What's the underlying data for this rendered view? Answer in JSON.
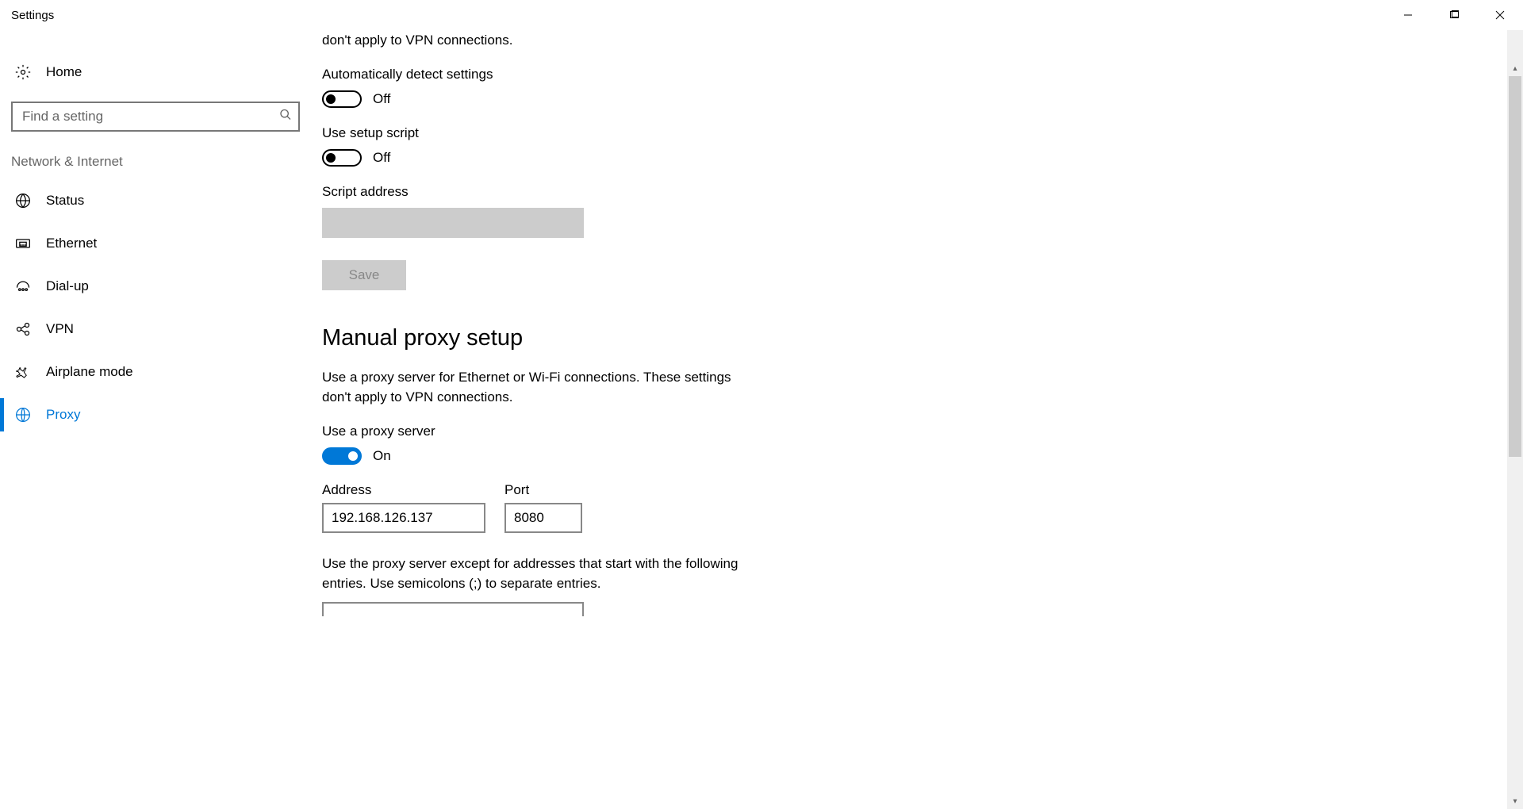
{
  "window": {
    "title": "Settings"
  },
  "sidebar": {
    "home": "Home",
    "search_placeholder": "Find a setting",
    "section": "Network & Internet",
    "items": [
      {
        "label": "Status"
      },
      {
        "label": "Ethernet"
      },
      {
        "label": "Dial-up"
      },
      {
        "label": "VPN"
      },
      {
        "label": "Airplane mode"
      },
      {
        "label": "Proxy"
      }
    ]
  },
  "main": {
    "auto_intro_tail": "don't apply to VPN connections.",
    "auto_detect_label": "Automatically detect settings",
    "auto_detect_state": "Off",
    "use_script_label": "Use setup script",
    "use_script_state": "Off",
    "script_address_label": "Script address",
    "script_address_value": "",
    "save_label": "Save",
    "manual_heading": "Manual proxy setup",
    "manual_intro": "Use a proxy server for Ethernet or Wi-Fi connections. These settings don't apply to VPN connections.",
    "use_proxy_label": "Use a proxy server",
    "use_proxy_state": "On",
    "address_label": "Address",
    "address_value": "192.168.126.137",
    "port_label": "Port",
    "port_value": "8080",
    "except_text": "Use the proxy server except for addresses that start with the following entries. Use semicolons (;) to separate entries.",
    "except_value": ""
  }
}
